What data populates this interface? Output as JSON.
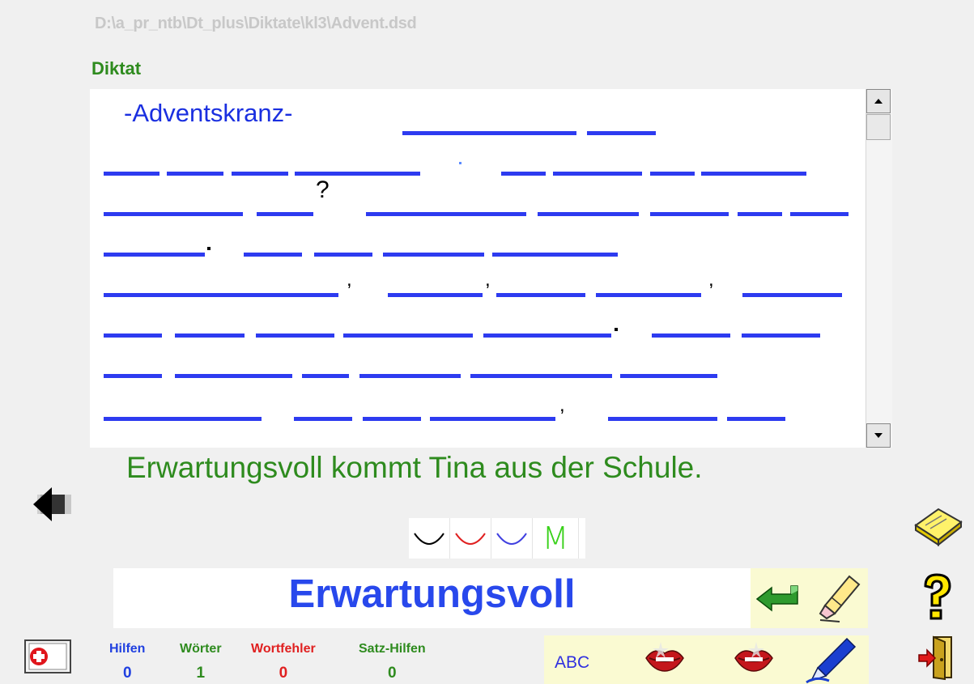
{
  "file_path": "D:\\a_pr_ntb\\Dt_plus\\Diktate\\kl3\\Advent.dsd",
  "section_title": "Diktat",
  "dictation": {
    "title": "-Adventskranz-",
    "punctuation": [
      "?",
      ",",
      ",",
      ","
    ]
  },
  "current_sentence": "Erwartungsvoll kommt Tina aus der Schule.",
  "current_word": "Erwartungsvoll",
  "palette": {
    "swatches": [
      "black",
      "red",
      "blue"
    ],
    "colors": [
      "#000000",
      "#e02020",
      "#4040e0"
    ],
    "m_label": "M"
  },
  "tools": {
    "abc_label": "ABC"
  },
  "stats": [
    {
      "label": "Hilfen",
      "value": "0",
      "color": "#2040e0"
    },
    {
      "label": "Wörter",
      "value": "1",
      "color": "#2e8b1e"
    },
    {
      "label": "Wortfehler",
      "value": "0",
      "color": "#e02020"
    },
    {
      "label": "Satz-Hilfen",
      "value": "0",
      "color": "#2e8b1e"
    }
  ],
  "icons": [
    "back-arrow-icon",
    "enter-arrow-icon",
    "eraser-pencil-icon",
    "lips-icon",
    "lips-icon",
    "pen-icon",
    "notes-icon",
    "help-icon",
    "exit-door-icon",
    "first-aid-icon"
  ]
}
